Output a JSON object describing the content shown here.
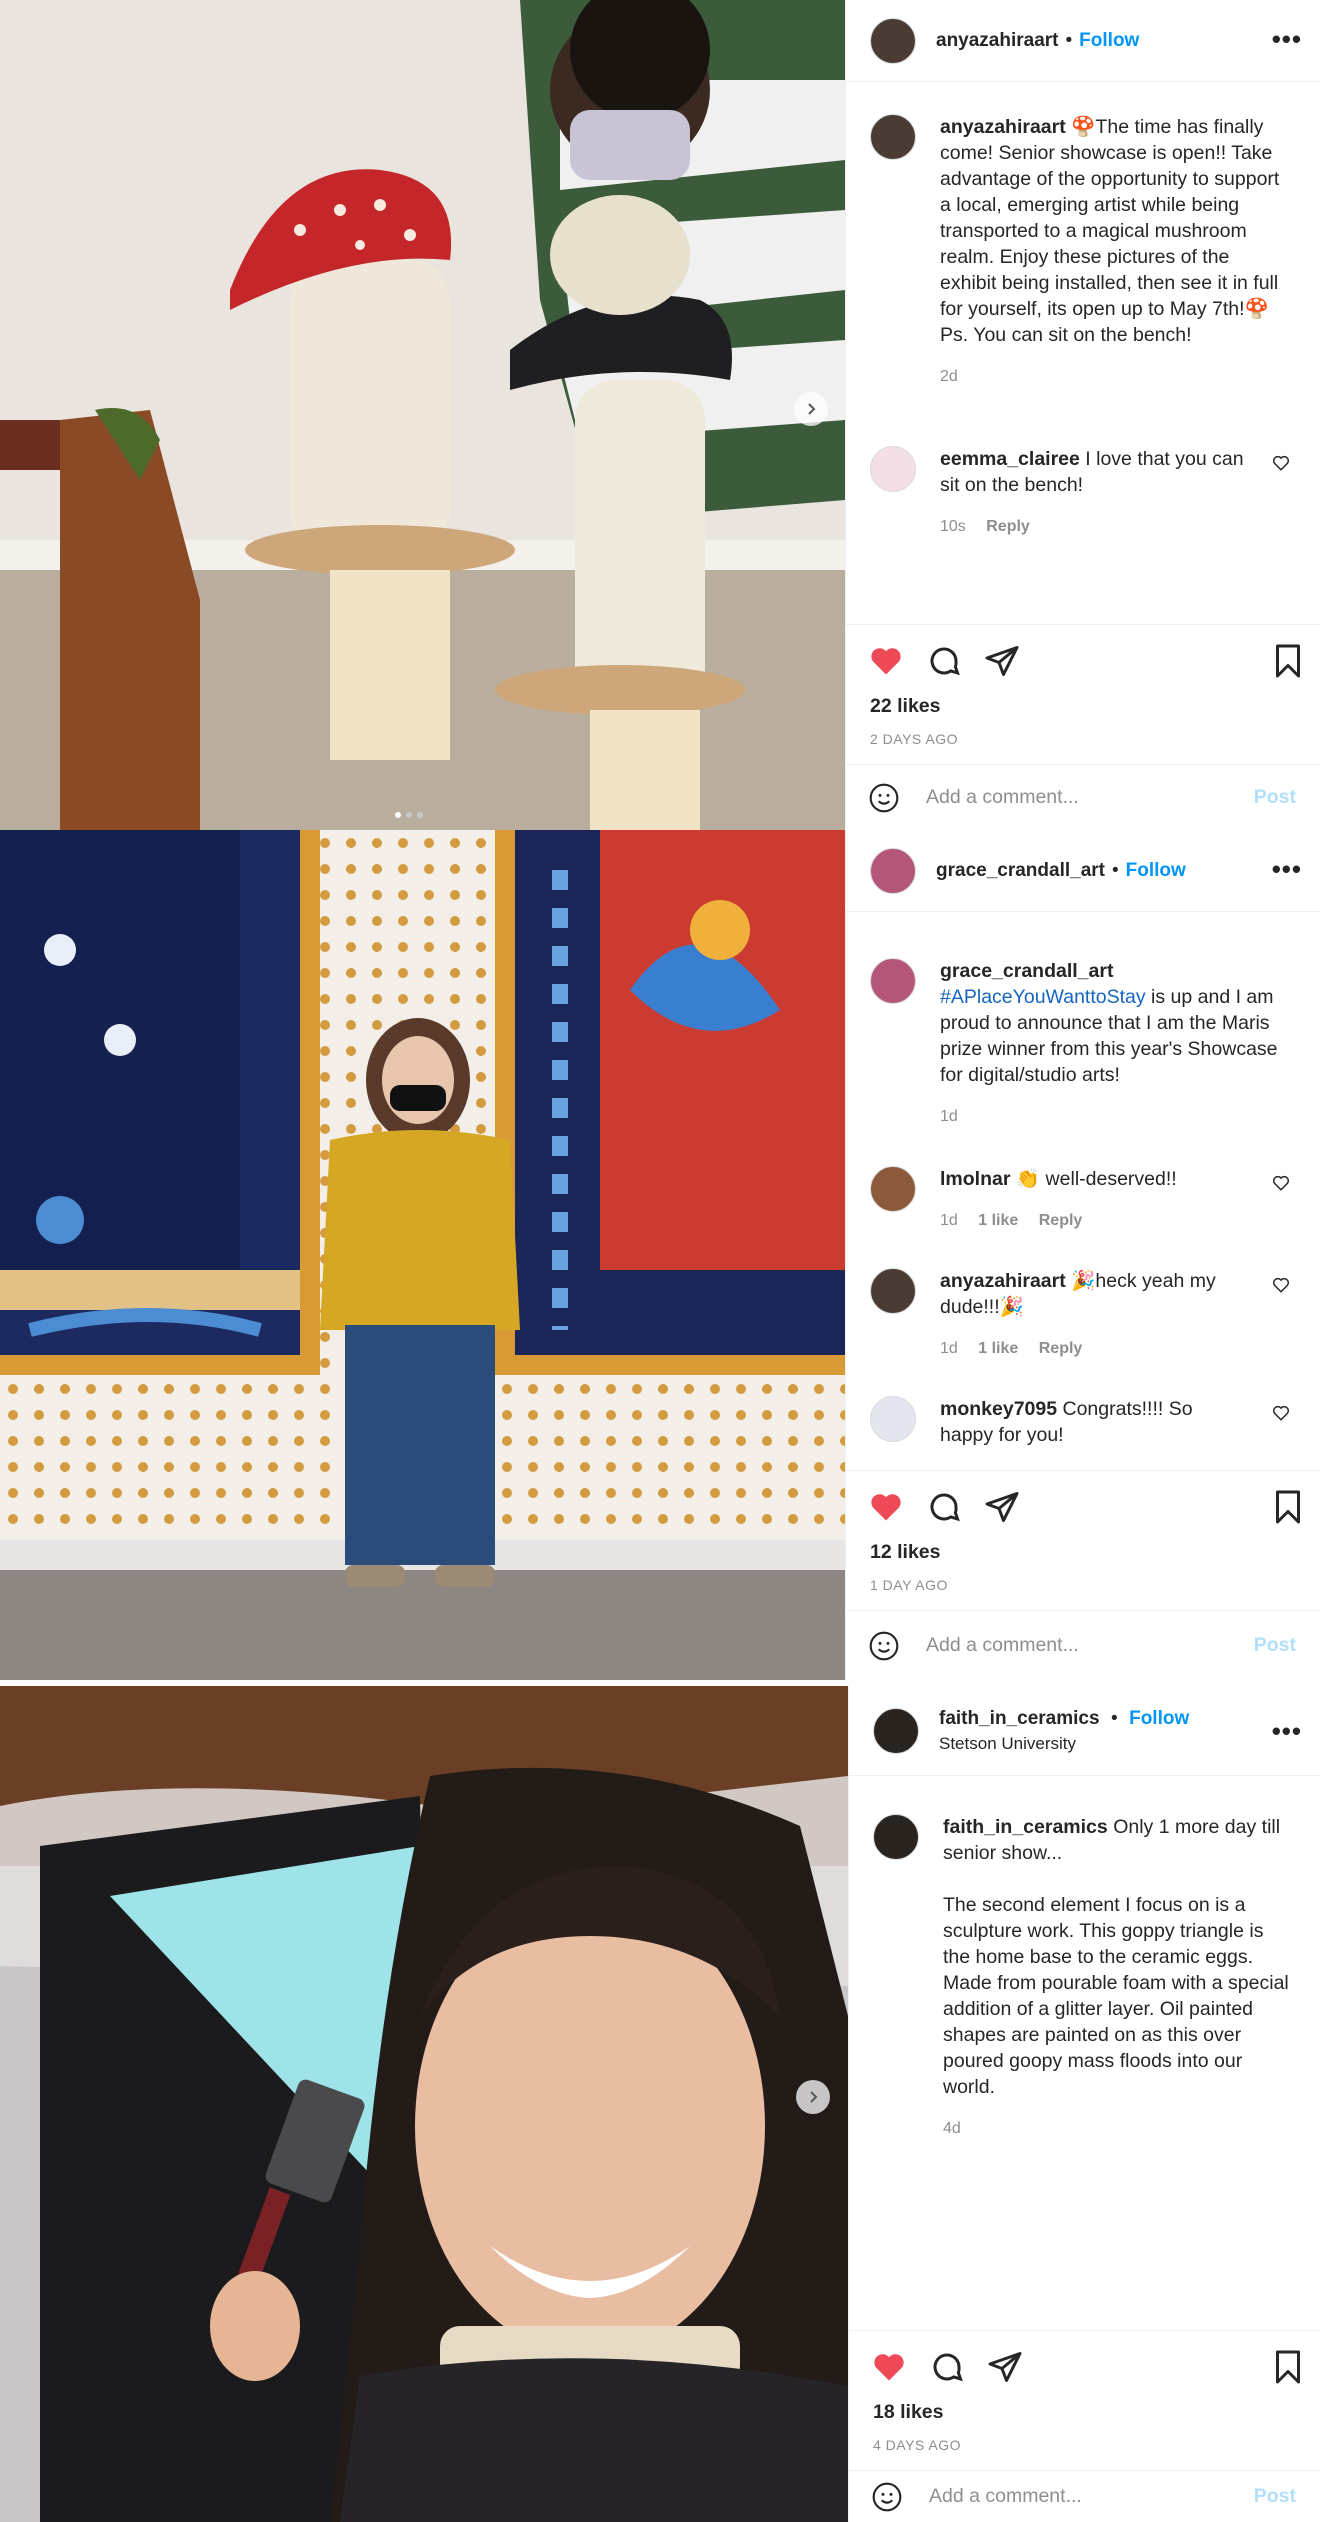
{
  "posts": [
    {
      "username": "anyazahiraart",
      "follow_label": "Follow",
      "caption": {
        "username": "anyazahiraart",
        "text": "🍄The time has finally come! Senior showcase is open!! Take advantage of the opportunity to support a local, emerging artist while being transported to a magical mushroom realm. Enjoy these pictures of the exhibit being installed, then see it in full for yourself, its open up to May 7th!🍄",
        "text2": "Ps. You can sit on the bench!",
        "time": "2d"
      },
      "comments": [
        {
          "username": "eemma_clairee",
          "text": "I love that you can sit on the bench!",
          "time": "10s",
          "reply": "Reply"
        }
      ],
      "likes": "22 likes",
      "ago": "2 DAYS AGO",
      "add_comment_placeholder": "Add a comment...",
      "post_label": "Post"
    },
    {
      "username": "grace_crandall_art",
      "follow_label": "Follow",
      "caption": {
        "username": "grace_crandall_art",
        "hashtag": "#APlaceYouWanttoStay",
        "text": " is up and I am proud to announce that I am the Maris prize winner from this year's Showcase for digital/studio arts!",
        "time": "1d"
      },
      "comments": [
        {
          "username": "lmolnar",
          "text": "👏 well-deserved!!",
          "time": "1d",
          "likes": "1 like",
          "reply": "Reply"
        },
        {
          "username": "anyazahiraart",
          "text": "🎉heck yeah my dude!!!🎉",
          "time": "1d",
          "likes": "1 like",
          "reply": "Reply"
        },
        {
          "username": "monkey7095",
          "text": "Congrats!!!! So happy for you!"
        }
      ],
      "likes": "12 likes",
      "ago": "1 DAY AGO",
      "add_comment_placeholder": "Add a comment...",
      "post_label": "Post"
    },
    {
      "username": "faith_in_ceramics",
      "follow_label": "Follow",
      "location": "Stetson University",
      "caption": {
        "username": "faith_in_ceramics",
        "text": "Only 1 more day till senior show...",
        "text2": "The second element I focus on is a sculpture work. This goppy triangle is the home base to the ceramic eggs. Made from pourable foam with a special addition of a glitter layer. Oil painted shapes are painted on as this over poured goopy mass floods into our world.",
        "time": "4d"
      },
      "likes": "18 likes",
      "ago": "4 DAYS AGO",
      "add_comment_placeholder": "Add a comment...",
      "post_label": "Post"
    }
  ],
  "colors": {
    "accent": "#0095f6",
    "heart": "#ed4956",
    "muted": "#8e8e8e"
  },
  "icons": [
    "heart-icon",
    "comment-icon",
    "share-icon",
    "bookmark-icon",
    "more-icon",
    "smiley-icon",
    "next-arrow-icon"
  ]
}
